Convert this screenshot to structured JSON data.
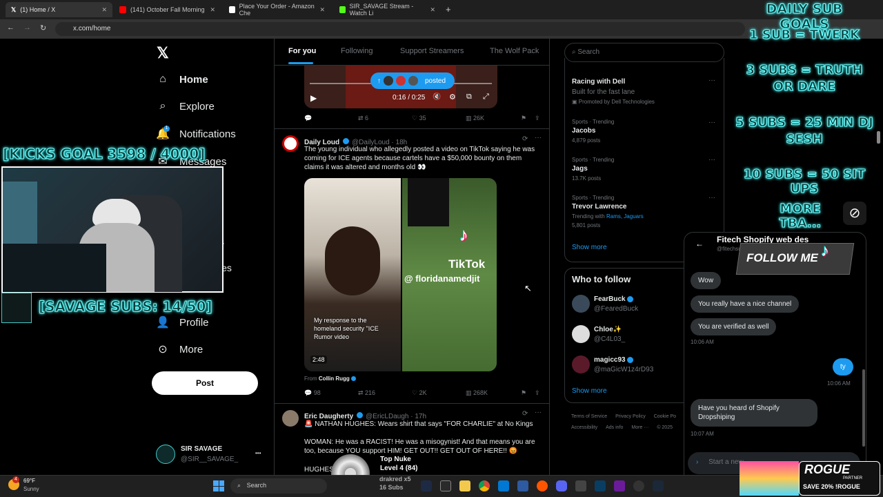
{
  "browser": {
    "tabs": [
      {
        "label": "(1) Home / X",
        "active": true
      },
      {
        "label": "(141) October Fall Morning",
        "active": false
      },
      {
        "label": "Place Your Order - Amazon Che",
        "active": false
      },
      {
        "label": "SIR_SAVAGE Stream - Watch Li",
        "active": false
      }
    ],
    "new_tab": "+",
    "url": "x.com/home"
  },
  "nav": {
    "items": [
      "Home",
      "Explore",
      "Notifications",
      "Messages",
      "Profile",
      "More"
    ],
    "partial_labels": [
      "s",
      "ies"
    ],
    "notif_count": "1",
    "post": "Post",
    "user_name": "SIR SAVAGE",
    "user_handle": "@SIR__SAVAGE_",
    "more_dots": "•••"
  },
  "feed": {
    "tabs": [
      "For you",
      "Following",
      "Support Streamers",
      "The Wolf Pack"
    ],
    "video_time": "0:16 / 0:25",
    "posted_pill": "posted",
    "actions1": {
      "reply": "",
      "retweet": "6",
      "like": "35",
      "views": "26K"
    },
    "tweet2": {
      "name": "Daily Loud",
      "handle": "@DailyLoud · 18h",
      "text": "The young individual who allegedly posted a video on TikTok saying he was coming for ICE agents because cartels have a $50,000 bounty on them claims it was altered and months old 👀",
      "caption": "My response to the homeland security \"ICE Rumor video",
      "tiktok": "TikTok",
      "tiktok_handle": "@ floridanamedjit",
      "duration": "2:48",
      "from_label": "From",
      "from_name": "Collin Rugg",
      "actions": {
        "reply": "98",
        "retweet": "216",
        "like": "2K",
        "views": "268K"
      }
    },
    "tweet3": {
      "name": "Eric Daugherty",
      "handle": "@EricLDaugh · 17h",
      "line1": "🚨 NATHAN HUGHES: Wears shirt that says \"FOR CHARLIE\" at No Kings",
      "line2": "WOMAN: He was a RACIST! He was a misogynist! And that means you are too, because YOU support HIM! GET OUT!! GET OUT OF HERE!! 😡",
      "line3": "HUGHES: 😂"
    }
  },
  "sidebar": {
    "search_placeholder": "Search",
    "promo": {
      "title": "Racing with Dell",
      "sub": "Built for the fast lane",
      "by": "Promoted by Dell Technologies"
    },
    "trends": [
      {
        "meta": "Sports · Trending",
        "title": "Jacobs",
        "count": "4,879 posts"
      },
      {
        "meta": "Sports · Trending",
        "title": "Jags",
        "count": "13.7K posts"
      },
      {
        "meta": "Sports · Trending",
        "title": "Trevor Lawrence",
        "with": "Trending with",
        "links": "Rams, Jaguars",
        "count": "5,801 posts"
      }
    ],
    "show_more": "Show more",
    "who_to_follow": "Who to follow",
    "follow": [
      {
        "name": "FearBuck",
        "handle": "@FearedBuck"
      },
      {
        "name": "Chloe✨",
        "handle": "@C4L03_"
      },
      {
        "name": "magicc93",
        "handle": "@maGicW1z4rD93"
      }
    ],
    "show_more2": "Show more",
    "footer1": [
      "Terms of Service",
      "Privacy Policy",
      "Cookie Po"
    ],
    "footer2": [
      "Accessibility",
      "Ads info",
      "More ···",
      "© 2025"
    ]
  },
  "dm": {
    "title": "Fitech Shopify web des",
    "handle": "@fitechsuport",
    "messages": [
      "Wow",
      "You really have a nice channel",
      "You are verified as well"
    ],
    "time1": "10:06 AM",
    "mine": "ty",
    "time2": "10:06 AM",
    "incoming2": "Have you heard of Shopify Dropshiping",
    "time3": "10:07 AM",
    "input_placeholder": "Start a new"
  },
  "overlay": {
    "kicks_goal": "[KICKS GOAL  3598 / 4000]",
    "savage_subs": "[SAVAGE SUBS: 14/50]",
    "goals_title": "DAILY SUB GOALS",
    "goals": [
      "1 SUB = TWERK",
      "3 SUBS = TRUTH OR DARE",
      "5 SUBS = 25 MIN DJ SESH",
      "10 SUBS = 50 SIT UPS",
      "MORE TBA..."
    ],
    "follow_me": "FOLLOW ME",
    "top_nuke": "Top Nuke",
    "level": "Level 4  (84)",
    "drakred": "drakred x5",
    "subs16": "16 Subs",
    "rogue_brand": "ROGUE",
    "rogue_partner": "PARTNER",
    "rogue_save": "SAVE 20% !ROGUE"
  },
  "taskbar": {
    "temp": "69°F",
    "weather": "Sunny",
    "search": "Search",
    "alert": "4"
  },
  "colors": {
    "accent": "#1d9bf0",
    "neon": "#55ffff",
    "background": "#000000"
  }
}
